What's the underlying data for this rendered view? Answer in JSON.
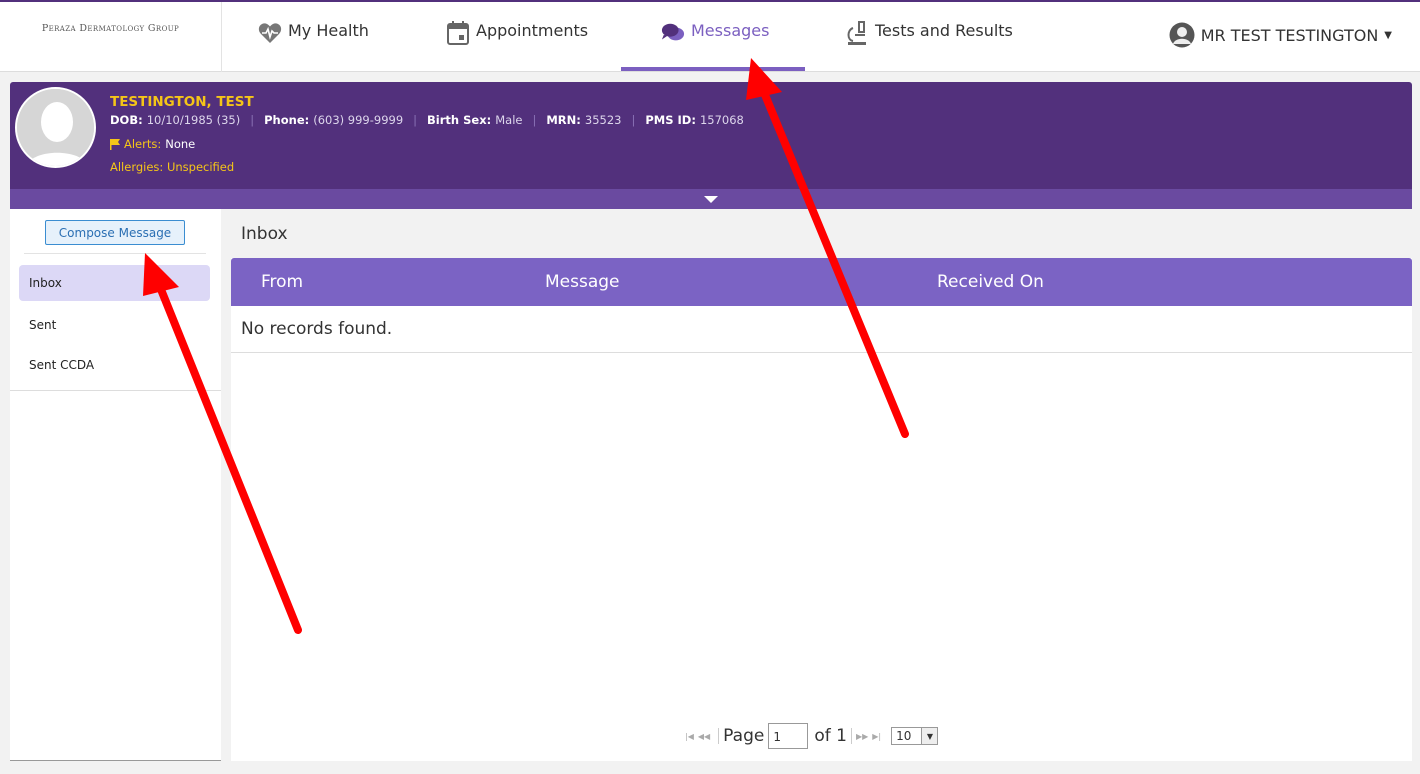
{
  "brand": {
    "name": "Peraza Dermatology Group"
  },
  "nav": {
    "items": [
      {
        "label": "My Health",
        "icon": "heart-pulse-icon"
      },
      {
        "label": "Appointments",
        "icon": "calendar-icon"
      },
      {
        "label": "Messages",
        "icon": "chat-bubbles-icon",
        "active": true
      },
      {
        "label": "Tests and Results",
        "icon": "microscope-icon"
      }
    ],
    "user": {
      "name": "MR TEST TESTINGTON",
      "icon": "user-avatar-icon"
    }
  },
  "patient": {
    "name": "TESTINGTON, TEST",
    "dob_label": "DOB:",
    "dob": "10/10/1985 (35)",
    "phone_label": "Phone:",
    "phone": "(603) 999-9999",
    "sex_label": "Birth Sex:",
    "sex": "Male",
    "mrn_label": "MRN:",
    "mrn": "35523",
    "pms_label": "PMS ID:",
    "pms": "157068",
    "alerts_label": "Alerts:",
    "alerts": "None",
    "allergies_label": "Allergies:",
    "allergies": "Unspecified"
  },
  "sidebar": {
    "compose_label": "Compose Message",
    "items": [
      {
        "label": "Inbox",
        "active": true
      },
      {
        "label": "Sent"
      },
      {
        "label": "Sent CCDA"
      }
    ]
  },
  "main": {
    "title": "Inbox",
    "columns": [
      "From",
      "Message",
      "Received On"
    ],
    "empty_text": "No records found."
  },
  "pager": {
    "page_label": "Page",
    "page_value": "1",
    "of_label": "of 1",
    "page_size": "10"
  },
  "colors": {
    "brand_purple": "#52307c",
    "accent_purple": "#7b5fc0",
    "header_purple": "#7b63c4",
    "alert_yellow": "#f5c518",
    "annotation_red": "#ff0000"
  }
}
